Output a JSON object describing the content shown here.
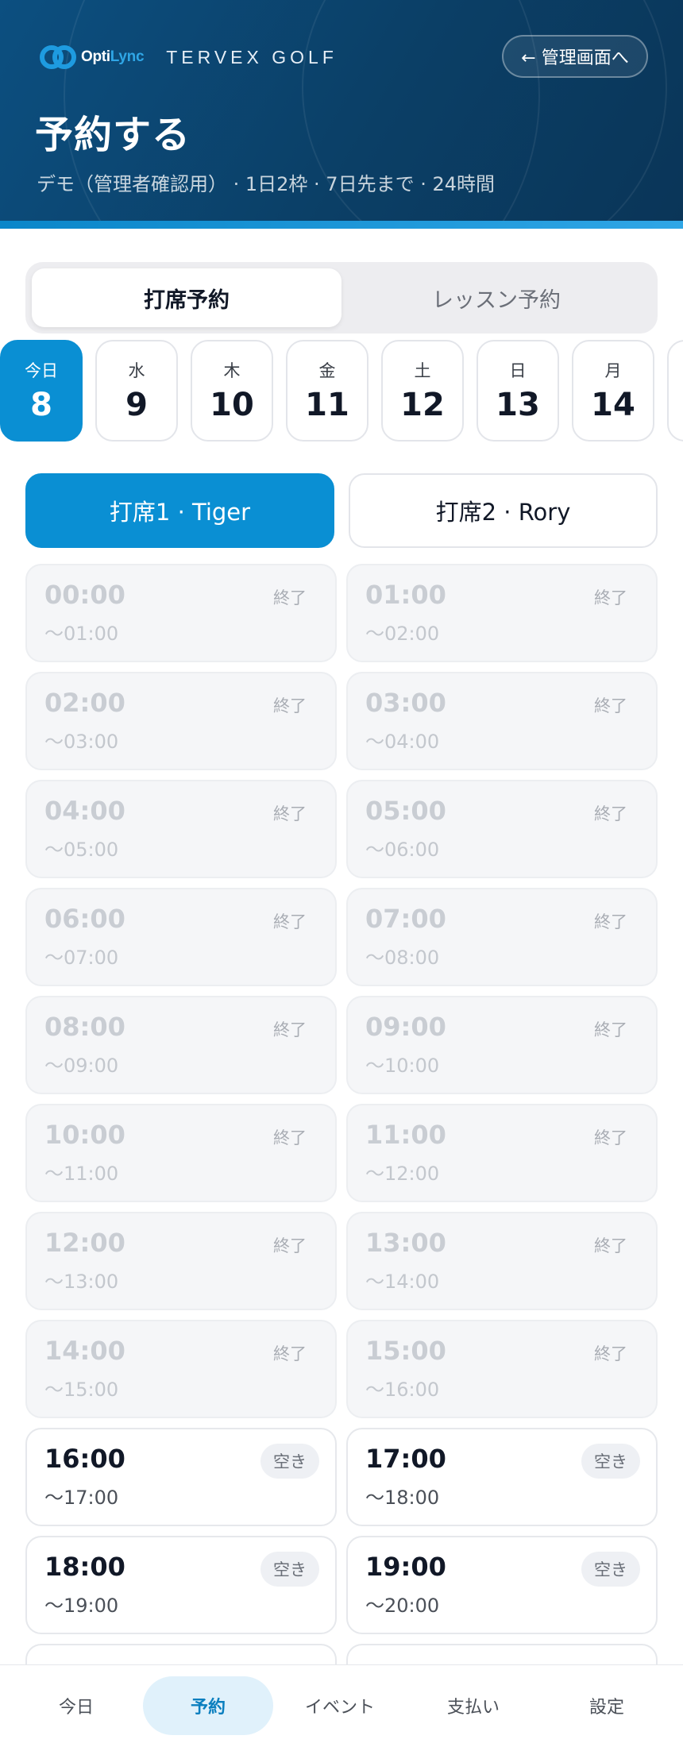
{
  "header": {
    "logo": {
      "part1": "Opti",
      "part2": "Lync"
    },
    "brand_name": "TERVEX GOLF",
    "admin_button": "← 管理画面へ",
    "title": "予約する",
    "subtitle": "デモ（管理者確認用） · 1日2枠 · 7日先まで · 24時間"
  },
  "colors": {
    "header_bg": "#0b3f66",
    "accent": "#0a8fd3",
    "nav_active_bg": "#e0f1fb"
  },
  "tabs": [
    {
      "label": "打席予約",
      "active": true
    },
    {
      "label": "レッスン予約",
      "active": false
    }
  ],
  "dates": [
    {
      "dow": "今日",
      "day": "8",
      "active": true
    },
    {
      "dow": "水",
      "day": "9"
    },
    {
      "dow": "木",
      "day": "10"
    },
    {
      "dow": "金",
      "day": "11"
    },
    {
      "dow": "土",
      "day": "12"
    },
    {
      "dow": "日",
      "day": "13"
    },
    {
      "dow": "月",
      "day": "14"
    },
    {
      "dow": "",
      "day": ""
    }
  ],
  "seats": [
    {
      "label": "打席1 · Tiger",
      "active": true
    },
    {
      "label": "打席2 · Rory",
      "active": false
    }
  ],
  "slots": [
    {
      "start": "00:00",
      "end": "〜01:00",
      "status": "終了"
    },
    {
      "start": "01:00",
      "end": "〜02:00",
      "status": "終了"
    },
    {
      "start": "02:00",
      "end": "〜03:00",
      "status": "終了"
    },
    {
      "start": "03:00",
      "end": "〜04:00",
      "status": "終了"
    },
    {
      "start": "04:00",
      "end": "〜05:00",
      "status": "終了"
    },
    {
      "start": "05:00",
      "end": "〜06:00",
      "status": "終了"
    },
    {
      "start": "06:00",
      "end": "〜07:00",
      "status": "終了"
    },
    {
      "start": "07:00",
      "end": "〜08:00",
      "status": "終了"
    },
    {
      "start": "08:00",
      "end": "〜09:00",
      "status": "終了"
    },
    {
      "start": "09:00",
      "end": "〜10:00",
      "status": "終了"
    },
    {
      "start": "10:00",
      "end": "〜11:00",
      "status": "終了"
    },
    {
      "start": "11:00",
      "end": "〜12:00",
      "status": "終了"
    },
    {
      "start": "12:00",
      "end": "〜13:00",
      "status": "終了"
    },
    {
      "start": "13:00",
      "end": "〜14:00",
      "status": "終了"
    },
    {
      "start": "14:00",
      "end": "〜15:00",
      "status": "終了"
    },
    {
      "start": "15:00",
      "end": "〜16:00",
      "status": "終了"
    },
    {
      "start": "16:00",
      "end": "〜17:00",
      "status": "空き"
    },
    {
      "start": "17:00",
      "end": "〜18:00",
      "status": "空き"
    },
    {
      "start": "18:00",
      "end": "〜19:00",
      "status": "空き"
    },
    {
      "start": "19:00",
      "end": "〜20:00",
      "status": "空き"
    },
    {
      "start": "",
      "end": "",
      "status": ""
    },
    {
      "start": "",
      "end": "",
      "status": ""
    }
  ],
  "nav": [
    {
      "label": "今日",
      "active": false
    },
    {
      "label": "予約",
      "active": true
    },
    {
      "label": "イベント",
      "active": false
    },
    {
      "label": "支払い",
      "active": false
    },
    {
      "label": "設定",
      "active": false
    }
  ]
}
